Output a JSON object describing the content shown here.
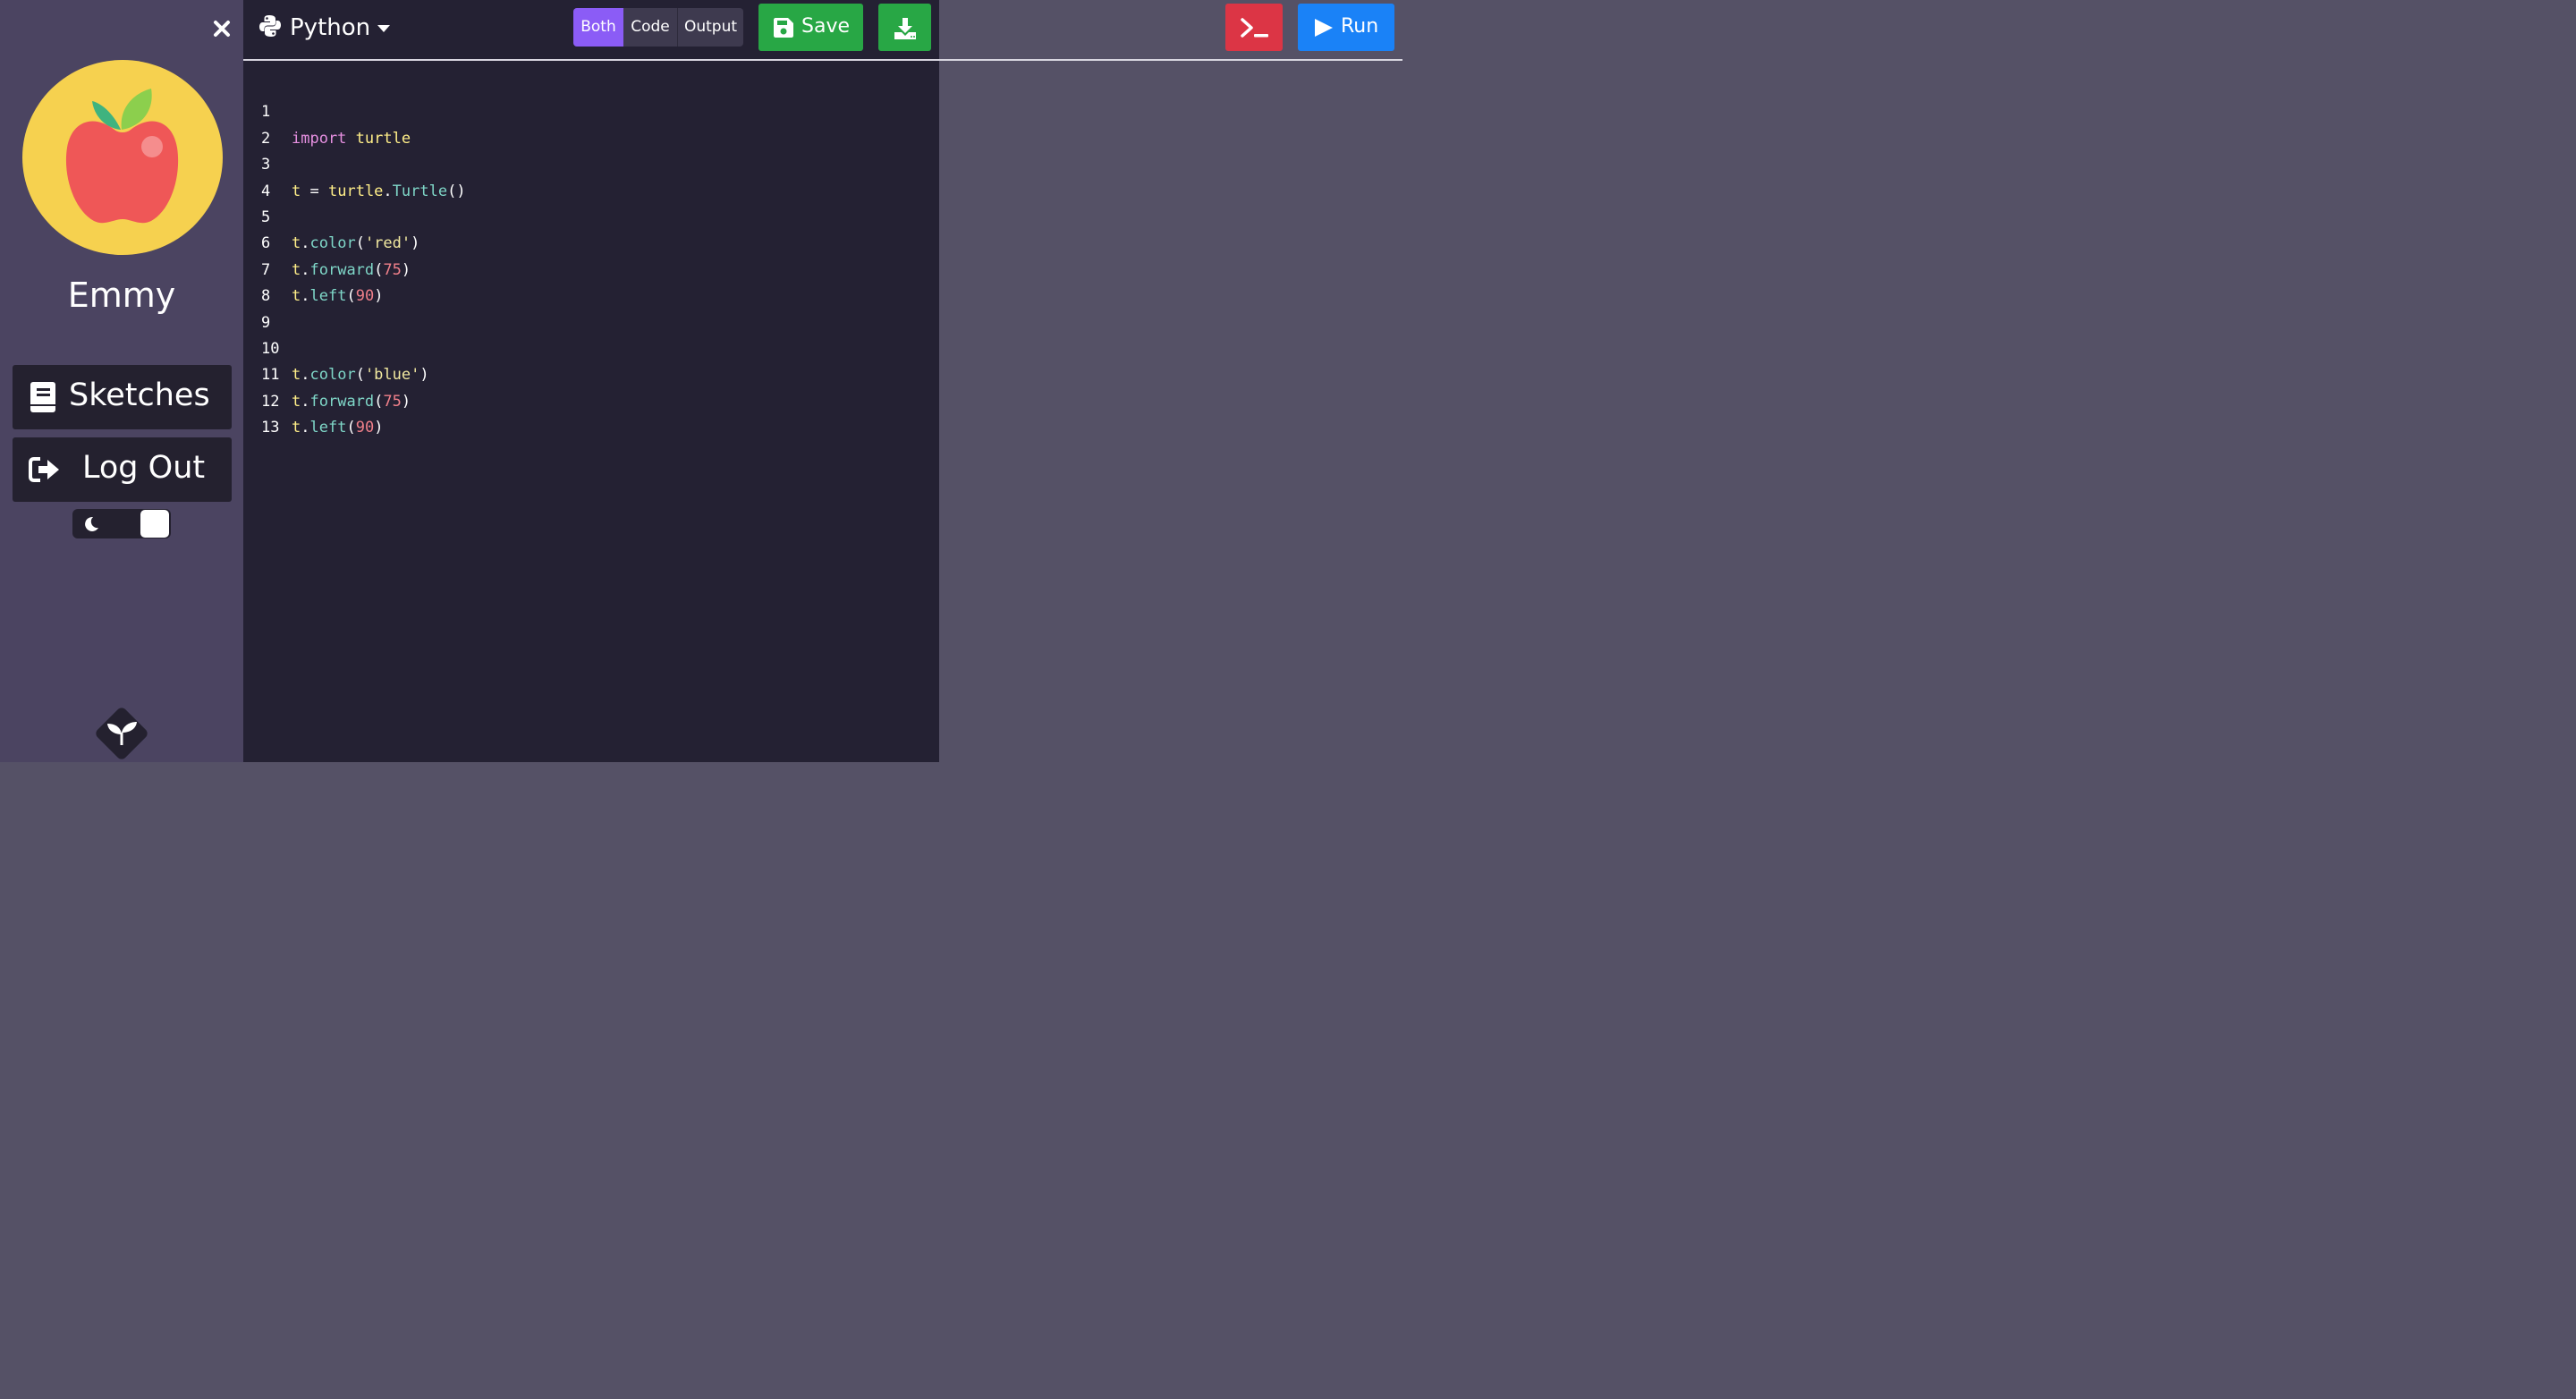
{
  "sidebar": {
    "close_icon": "times-icon",
    "username": "Emmy",
    "sketches_label": "Sketches",
    "logout_label": "Log Out",
    "theme_toggle": {
      "icon": "moon-icon",
      "state": "dark"
    }
  },
  "toolbar": {
    "language": "Python",
    "language_icon": "python-icon",
    "views": [
      "Both",
      "Code",
      "Output"
    ],
    "active_view": "Both",
    "save_label": "Save",
    "run_label": "Run",
    "colors": {
      "save": "#28a745",
      "console": "#dc3545",
      "run": "#1a82f7",
      "active_view": "#8b5cf6"
    }
  },
  "editor": {
    "line_numbers": [
      "1",
      "2",
      "3",
      "4",
      "5",
      "6",
      "7",
      "8",
      "9",
      "10",
      "11",
      "12",
      "13"
    ],
    "lines": [
      "import turtle",
      "",
      "t = turtle.Turtle()",
      "",
      "t.color('red')",
      "t.forward(75)",
      "t.left(90)",
      "",
      "",
      "t.color('blue')",
      "t.forward(75)",
      "t.left(90)",
      ""
    ]
  }
}
